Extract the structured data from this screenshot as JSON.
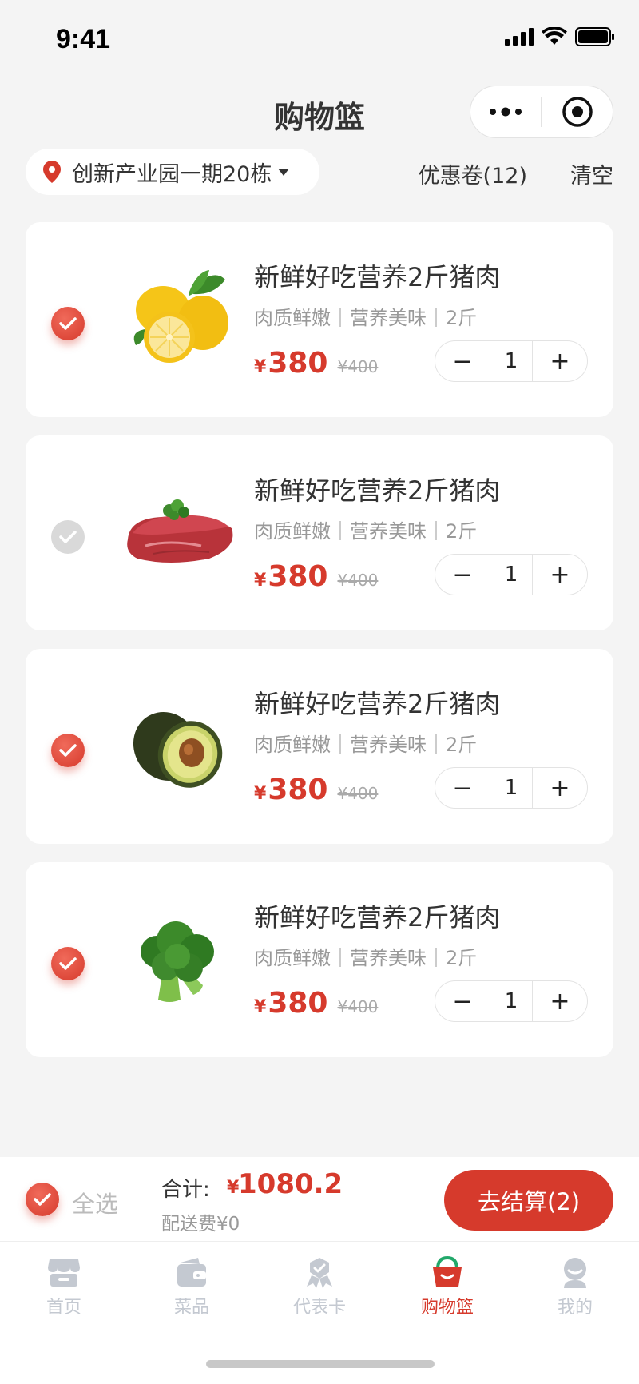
{
  "status_bar": {
    "time": "9:41"
  },
  "nav": {
    "title": "购物篮"
  },
  "address": {
    "text": "创新产业园一期20栋"
  },
  "actions": {
    "coupon": "优惠卷(12)",
    "clear": "清空"
  },
  "items": [
    {
      "title": "新鲜好吃营养2斤猪肉",
      "desc": "肉质鲜嫩｜营养美味｜2斤",
      "currency": "¥",
      "price": "380",
      "old_price": "¥400",
      "qty": "1",
      "selected": true,
      "image": "lemon"
    },
    {
      "title": "新鲜好吃营养2斤猪肉",
      "desc": "肉质鲜嫩｜营养美味｜2斤",
      "currency": "¥",
      "price": "380",
      "old_price": "¥400",
      "qty": "1",
      "selected": false,
      "image": "steak"
    },
    {
      "title": "新鲜好吃营养2斤猪肉",
      "desc": "肉质鲜嫩｜营养美味｜2斤",
      "currency": "¥",
      "price": "380",
      "old_price": "¥400",
      "qty": "1",
      "selected": true,
      "image": "avocado"
    },
    {
      "title": "新鲜好吃营养2斤猪肉",
      "desc": "肉质鲜嫩｜营养美味｜2斤",
      "currency": "¥",
      "price": "380",
      "old_price": "¥400",
      "qty": "1",
      "selected": true,
      "image": "broccoli"
    }
  ],
  "stepper": {
    "minus": "−",
    "plus": "+"
  },
  "checkout": {
    "select_all": "全选",
    "total_label": "合计:",
    "currency": "¥",
    "total_value": "1080.2",
    "delivery": "配送费¥0",
    "button": "去结算(2)"
  },
  "tabs": [
    {
      "label": "首页",
      "icon": "store-icon",
      "active": false
    },
    {
      "label": "菜品",
      "icon": "wallet-icon",
      "active": false
    },
    {
      "label": "代表卡",
      "icon": "badge-icon",
      "active": false
    },
    {
      "label": "购物篮",
      "icon": "basket-icon",
      "active": true
    },
    {
      "label": "我的",
      "icon": "user-icon",
      "active": false
    }
  ],
  "colors": {
    "accent": "#d63a2c",
    "inactive_tab": "#c4c9d1",
    "background": "#f4f4f4"
  }
}
